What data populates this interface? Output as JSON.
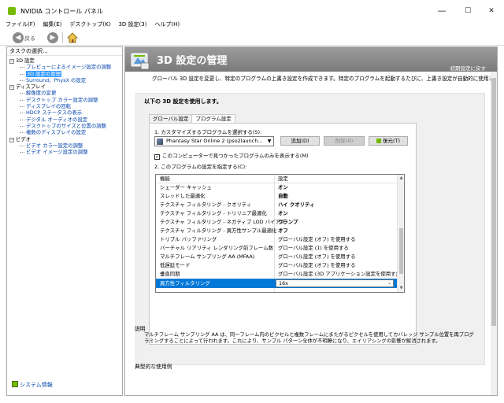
{
  "window": {
    "title": "NVIDIA コントロール パネル",
    "minimize": "—",
    "maximize": "☐",
    "close": "✕"
  },
  "menu": [
    "ファイル(F)",
    "編集(E)",
    "デスクトップ(K)",
    "3D 設定(3)",
    "ヘルプ(H)"
  ],
  "toolbar": {
    "back": "戻る"
  },
  "sidebar": {
    "header": "タスクの選択...",
    "tree": [
      {
        "kind": "cat",
        "label": "3D 設定"
      },
      {
        "kind": "child",
        "label": "プレビューによるイメージ設定の調整"
      },
      {
        "kind": "child",
        "label": "3D 設定の管理",
        "selected": true
      },
      {
        "kind": "child",
        "label": "Surround、PhysX の設定"
      },
      {
        "kind": "cat",
        "label": "ディスプレイ"
      },
      {
        "kind": "child",
        "label": "解像度の変更"
      },
      {
        "kind": "child",
        "label": "デスクトップ カラー設定の調整"
      },
      {
        "kind": "child",
        "label": "ディスプレイの回転"
      },
      {
        "kind": "child",
        "label": "HDCP ステータスの表示"
      },
      {
        "kind": "child",
        "label": "デジタル オーディオの設定"
      },
      {
        "kind": "child",
        "label": "デスクトップのサイズと位置の調整"
      },
      {
        "kind": "child",
        "label": "複数のディスプレイの設定"
      },
      {
        "kind": "cat",
        "label": "ビデオ"
      },
      {
        "kind": "child",
        "label": "ビデオ カラー設定の調整"
      },
      {
        "kind": "child",
        "label": "ビデオ イメージ設定の調整"
      }
    ],
    "system_info": "システム情報"
  },
  "main": {
    "title": "3D 設定の管理",
    "restore_defaults": "初期設定に戻す",
    "description": "グローバル 3D 設定を変更し、特定のプログラムの上書き設定を作成できます。特定のプログラムを起動するたびに、上書き設定が自動的に使用されます。",
    "panel_heading": "以下の 3D 設定を使用します。",
    "tabs": [
      "グローバル設定",
      "プログラム設定"
    ],
    "step1_label": "1. カスタマイズするプログラムを選択する(S):",
    "program_selected": "Phantasy Star Online 2 (pso2launch...",
    "add_button": "追加(D)",
    "remove_button": "削除(R)",
    "restore_button": "復元(T)",
    "show_only_found": "このコンピューターで見つかったプログラムのみを表示する(M)",
    "show_only_found_checked": true,
    "step2_label": "2. このプログラムの設定を指定する(C):",
    "grid": {
      "col_feature": "機能",
      "col_setting": "設定",
      "rows": [
        {
          "feature": "シェーダー キャッシュ",
          "setting": "オン",
          "bold": true
        },
        {
          "feature": "スレッドした最適化",
          "setting": "自動",
          "bold": true
        },
        {
          "feature": "テクスチャ フィルタリング - クオリティ",
          "setting": "ハイ クオリティ",
          "bold": true
        },
        {
          "feature": "テクスチャ フィルタリング - トリリニア最適化",
          "setting": "オン",
          "bold": true
        },
        {
          "feature": "テクスチャ フィルタリング - ネガティブ LOD バイアス",
          "setting": "クランプ",
          "bold": true
        },
        {
          "feature": "テクスチャ フィルタリング - 異方性サンプル最適化",
          "setting": "オフ",
          "bold": true
        },
        {
          "feature": "トリプル バッファリング",
          "setting": "グローバル設定 (オフ) を使用する",
          "bold": false
        },
        {
          "feature": "バーチャル リアリティ レンダリング前フレーム数",
          "setting": "グローバル設定 (1) を使用する",
          "bold": false
        },
        {
          "feature": "マルチフレーム サンプリング AA (MFAA)",
          "setting": "グローバル設定 (オフ) を使用する",
          "bold": false
        },
        {
          "feature": "低遅延モード",
          "setting": "グローバル設定 (オフ) を使用する",
          "bold": false
        },
        {
          "feature": "垂直同期",
          "setting": "グローバル設定 (3D アプリケーション設定を使用す)",
          "bold": false
        }
      ],
      "selected_row": {
        "feature": "異方性フィルタリング",
        "setting": "16x"
      }
    },
    "explanation_title": "説明",
    "explanation": "マルチフレーム サンプリング AA は、同一フレーム内のピクセルと複数フレームにまたがるピクセルを使用してカバレッジ サンプル位置を再プログラミングすることによって行われます。これにより、サンプル パターン全体が不明瞭になり、エイリアシングの影響が解消されます。",
    "usage_title": "典型的な使用例"
  },
  "colors": {
    "nvidia_green": "#76b900",
    "selection_blue": "#0078d7",
    "link_blue": "#0645ad"
  }
}
